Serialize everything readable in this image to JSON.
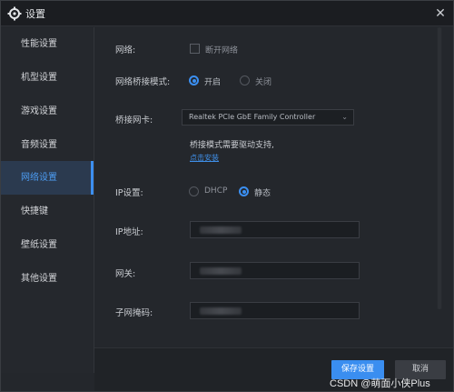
{
  "window": {
    "title": "设置",
    "icons": {
      "settings": "gear-icon",
      "close": "close-icon"
    },
    "close_glyph": "✕"
  },
  "sidebar": {
    "items": [
      {
        "label": "性能设置"
      },
      {
        "label": "机型设置"
      },
      {
        "label": "游戏设置"
      },
      {
        "label": "音频设置"
      },
      {
        "label": "网络设置",
        "active": true
      },
      {
        "label": "快捷键"
      },
      {
        "label": "壁纸设置"
      },
      {
        "label": "其他设置"
      }
    ]
  },
  "network": {
    "network_label": "网络:",
    "disconnect_label": "断开网络",
    "disconnect_checked": false,
    "bridge_mode_label": "网络桥接模式:",
    "bridge_on_label": "开启",
    "bridge_off_label": "关闭",
    "bridge_mode_selected": "开启",
    "bridge_nic_label": "桥接网卡:",
    "bridge_nic_value": "Realtek PCIe GbE Family Controller",
    "driver_note": "桥接模式需要驱动支持,",
    "install_link": "点击安装",
    "ip_setting_label": "IP设置:",
    "dhcp_label": "DHCP",
    "static_label": "静态",
    "ip_mode_selected": "静态",
    "ip_address_label": "IP地址:",
    "gateway_label": "网关:",
    "subnet_label": "子网掩码:"
  },
  "footer": {
    "save_label": "保存设置",
    "cancel_label": "取消"
  },
  "watermark": "CSDN @萌面小侠Plus",
  "colors": {
    "accent": "#3a8ef0",
    "background": "#24272c",
    "active_nav_bg": "#2b3a4f"
  }
}
